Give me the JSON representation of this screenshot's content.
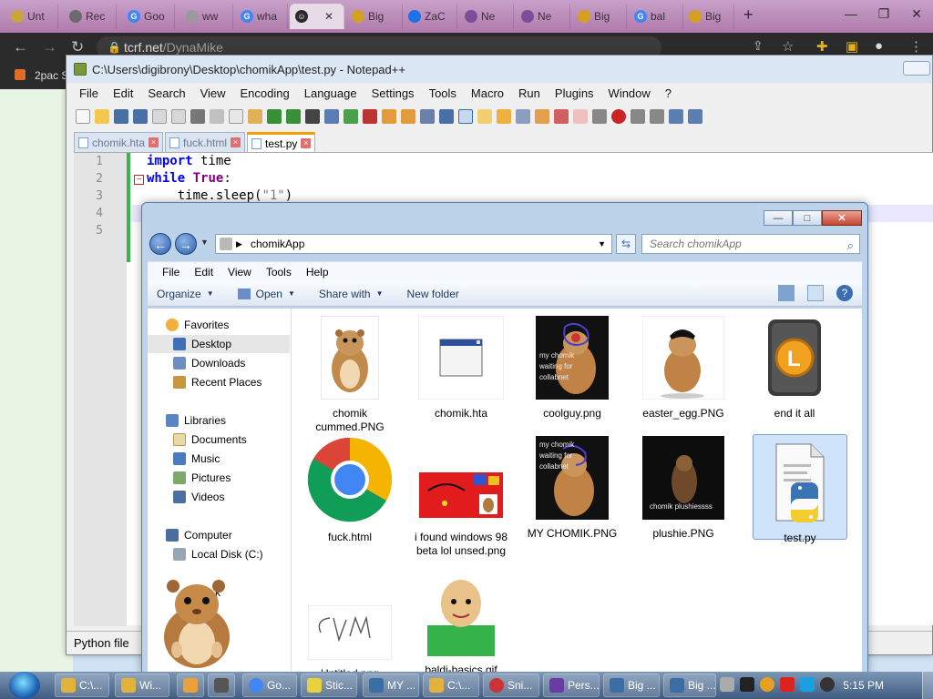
{
  "chrome": {
    "tabs": [
      {
        "label": "Unt",
        "color": "#c9a53a"
      },
      {
        "label": "Rec",
        "color": "#6b6b6b"
      },
      {
        "label": "Goo",
        "color": "#4285f4"
      },
      {
        "label": "ww",
        "color": "#9a9a9a"
      },
      {
        "label": "wha",
        "color": "#4285f4"
      },
      {
        "label": "",
        "color": "#2b2b2b"
      },
      {
        "label": "Big",
        "color": "#d4a021"
      },
      {
        "label": "ZaC",
        "color": "#1a73e8"
      },
      {
        "label": "Ne",
        "color": "#7e4d9a"
      },
      {
        "label": "Ne",
        "color": "#7e4d9a"
      },
      {
        "label": "Big",
        "color": "#d4a021"
      },
      {
        "label": "bal",
        "color": "#4285f4"
      },
      {
        "label": "Big",
        "color": "#d4a021"
      }
    ],
    "url_domain": "tcrf.net",
    "url_path": "/DynaMike",
    "bookmark": "2pac S"
  },
  "notepad": {
    "title": "C:\\Users\\digibrony\\Desktop\\chomikApp\\test.py - Notepad++",
    "menu": [
      "File",
      "Edit",
      "Search",
      "View",
      "Encoding",
      "Language",
      "Settings",
      "Tools",
      "Macro",
      "Run",
      "Plugins",
      "Window",
      "?"
    ],
    "tabs": [
      {
        "label": "chomik.hta",
        "active": false
      },
      {
        "label": "fuck.html",
        "active": false
      },
      {
        "label": "test.py",
        "active": true
      }
    ],
    "line_numbers": [
      "1",
      "2",
      "3",
      "4",
      "5"
    ],
    "code": {
      "l1_kw": "import",
      "l1_rest": " time",
      "l2_kw": "while",
      "l2_sp": " ",
      "l2_kw2": "True",
      "l2_rest": ":",
      "l3_indent": "    time.sleep(",
      "l3_str": "\"1\"",
      "l3_end": ")"
    },
    "status": "Python file"
  },
  "explorer": {
    "address": "chomikApp",
    "search_placeholder": "Search chomikApp",
    "menu": [
      "File",
      "Edit",
      "View",
      "Tools",
      "Help"
    ],
    "commands": {
      "organize": "Organize",
      "open": "Open",
      "share": "Share with",
      "new_folder": "New folder"
    },
    "sidebar": {
      "favorites": "Favorites",
      "desktop": "Desktop",
      "downloads": "Downloads",
      "recent": "Recent Places",
      "libraries": "Libraries",
      "documents": "Documents",
      "music": "Music",
      "pictures": "Pictures",
      "videos": "Videos",
      "computer": "Computer",
      "local_disk": "Local Disk (C:)",
      "network_partial": "k"
    },
    "files": [
      {
        "name": "chomik cummed.PNG"
      },
      {
        "name": "chomik.hta"
      },
      {
        "name": "coolguy.png",
        "overlay": "my chomik waiting for collabnet"
      },
      {
        "name": "easter_egg.PNG"
      },
      {
        "name": "end it all"
      },
      {
        "name": "fuck.html"
      },
      {
        "name": "i found windows 98 beta lol unsed.png"
      },
      {
        "name": "MY CHOMIK.PNG",
        "overlay": "my chomik waiting for collabnet"
      },
      {
        "name": "plushie.PNG",
        "overlay": "chomik plushiessss"
      },
      {
        "name": "test.py"
      },
      {
        "name": "Untitled.png"
      },
      {
        "name": "baldi-basics.gif"
      }
    ]
  },
  "taskbar": {
    "items": [
      {
        "label": "C:\\...",
        "color": "#e2b33c"
      },
      {
        "label": "Wi...",
        "color": "#e2b33c"
      },
      {
        "label": "",
        "color": "#e8a23b"
      },
      {
        "label": "",
        "color": "#555555"
      },
      {
        "label": "Go...",
        "color": "#4285f4"
      },
      {
        "label": "Stic...",
        "color": "#e8d23b"
      },
      {
        "label": "MY ...",
        "color": "#3a6ea5"
      },
      {
        "label": "C:\\...",
        "color": "#e2b33c"
      },
      {
        "label": "Sni...",
        "color": "#c33"
      },
      {
        "label": "Pers...",
        "color": "#6a3aa5"
      },
      {
        "label": "Big ...",
        "color": "#3a6ea5"
      },
      {
        "label": "Big ...",
        "color": "#3a6ea5"
      }
    ],
    "clock": "5:15 PM"
  }
}
